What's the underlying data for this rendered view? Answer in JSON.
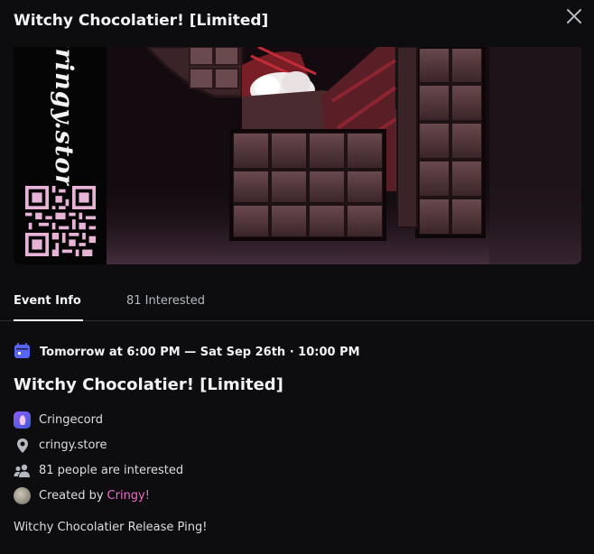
{
  "modal": {
    "title": "Witchy Chocolatier! [Limited]",
    "close_icon": "close-icon"
  },
  "banner": {
    "brand_text": "cringy.store",
    "qr_icon": "qr-code-icon"
  },
  "tabs": [
    {
      "label": "Event Info",
      "active": true
    },
    {
      "label": "81 Interested",
      "active": false
    }
  ],
  "event": {
    "when": "Tomorrow at 6:00 PM — Sat Sep 26th · 10:00 PM",
    "title": "Witchy Chocolatier! [Limited]",
    "server": "Cringecord",
    "location": "cringy.store",
    "interested": "81 people are interested",
    "created_by_prefix": "Created by",
    "creator": "Cringy!",
    "description": "Witchy Chocolatier Release Ping!"
  },
  "colors": {
    "calendar": "#5865f2",
    "creator_link": "#eb6ec7",
    "background": "#0d0d0f"
  }
}
